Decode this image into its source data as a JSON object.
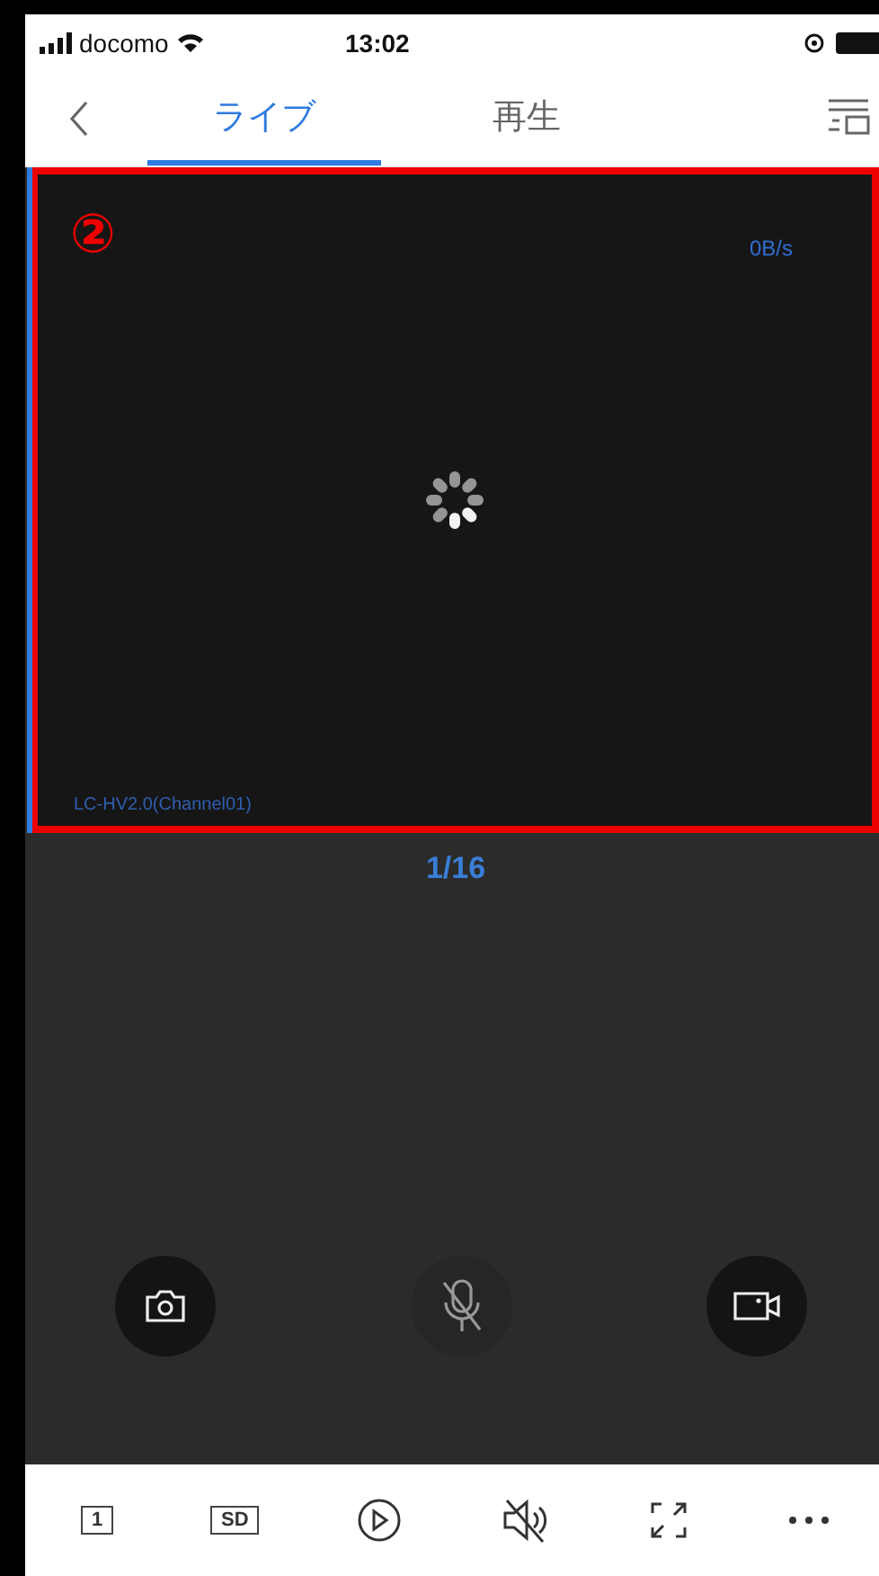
{
  "status_bar": {
    "carrier": "docomo",
    "time": "13:02"
  },
  "tabs": [
    {
      "label": "ライブ",
      "selected": true
    },
    {
      "label": "再生",
      "selected": false
    }
  ],
  "video": {
    "annotation": "②",
    "speed": "0B/s",
    "channel": "LC-HV2.0(Channel01)",
    "loading": true
  },
  "page_indicator": "1/16",
  "actions": [
    {
      "kind": "snapshot"
    },
    {
      "kind": "mic",
      "muted": true
    },
    {
      "kind": "record"
    }
  ],
  "toolbar": [
    {
      "kind": "layout",
      "label": "1"
    },
    {
      "kind": "quality",
      "label": "SD"
    },
    {
      "kind": "playback"
    },
    {
      "kind": "sound",
      "muted": true
    },
    {
      "kind": "fullscreen"
    },
    {
      "kind": "more"
    }
  ]
}
